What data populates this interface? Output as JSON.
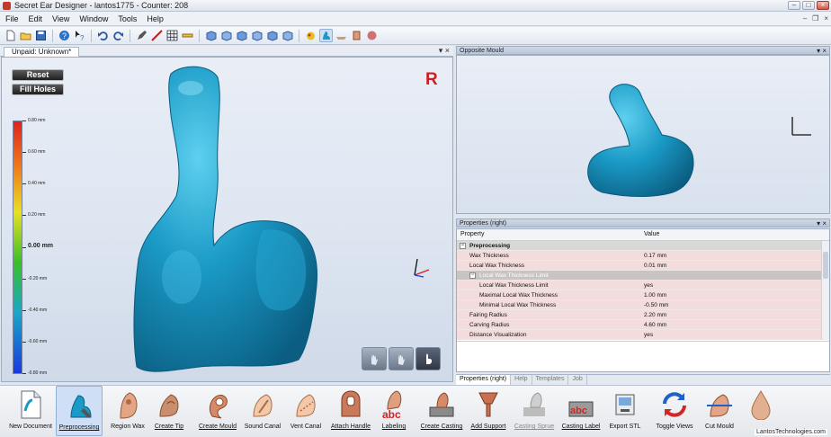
{
  "window": {
    "title": "Secret Ear Designer - lantos1775 - Counter: 208"
  },
  "menu": [
    "File",
    "Edit",
    "View",
    "Window",
    "Tools",
    "Help"
  ],
  "toolbar": {
    "icons": [
      "new-icon",
      "open-icon",
      "save-icon",
      "help-icon",
      "context-help-icon",
      "undo-icon",
      "redo-icon",
      "pen-icon",
      "slice-icon",
      "grid-icon",
      "ruler-icon",
      "view-cube-front-icon",
      "view-cube-back-icon",
      "view-cube-left-icon",
      "view-cube-right-icon",
      "view-cube-top-icon",
      "view-cube-bottom-icon",
      "color-shell-icon",
      "shell-display-icon",
      "tool-a-icon",
      "tool-b-icon",
      "tool-c-icon"
    ]
  },
  "left_pane": {
    "tab_label": "Unpaid: Unknown*",
    "reset_label": "Reset",
    "fill_holes_label": "Fill Holes",
    "side_marker": "R",
    "colorbar_labels": [
      "0.80 mm",
      "0.60 mm",
      "0.40 mm",
      "0.20 mm",
      "0.00 mm",
      "-0.20 mm",
      "-0.40 mm",
      "-0.60 mm",
      "-0.80 mm"
    ]
  },
  "opposite_pane": {
    "title": "Opposite Mould"
  },
  "properties": {
    "title": "Properties (right)",
    "col_property": "Property",
    "col_value": "Value",
    "rows": [
      {
        "type": "cat",
        "name": "Preprocessing",
        "value": ""
      },
      {
        "type": "item",
        "name": "Wax Thickness",
        "value": "0.17 mm"
      },
      {
        "type": "item",
        "name": "Local Wax Thickness",
        "value": "0.01 mm"
      },
      {
        "type": "subcat",
        "name": "Local Wax Thickness Limit",
        "value": ""
      },
      {
        "type": "subitem",
        "name": "Local Wax Thickness Limit",
        "value": "yes"
      },
      {
        "type": "subitem",
        "name": "Maximal Local Wax Thickness",
        "value": "1.00 mm"
      },
      {
        "type": "subitem",
        "name": "Minimal Local Wax Thickness",
        "value": "-0.50 mm"
      },
      {
        "type": "item",
        "name": "Fairing Radius",
        "value": "2.20 mm"
      },
      {
        "type": "item",
        "name": "Carving Radius",
        "value": "4.60 mm"
      },
      {
        "type": "item",
        "name": "Distance Visualization",
        "value": "yes"
      }
    ],
    "tabs": [
      "Properties (right)",
      "Help",
      "Templates",
      "Job"
    ]
  },
  "bottom_tools": [
    {
      "label": "New Document",
      "icon": "new-document-icon",
      "style": "plain"
    },
    {
      "label": "Preprocessing",
      "icon": "preprocessing-icon",
      "style": "selected"
    },
    {
      "label": "Region Wax",
      "icon": "region-wax-icon",
      "style": "plain"
    },
    {
      "label": "Create Tip",
      "icon": "create-tip-icon",
      "style": "underline"
    },
    {
      "label": "Create Mould",
      "icon": "create-mould-icon",
      "style": "underline"
    },
    {
      "label": "Sound Canal",
      "icon": "sound-canal-icon",
      "style": "plain"
    },
    {
      "label": "Vent Canal",
      "icon": "vent-canal-icon",
      "style": "plain"
    },
    {
      "label": "Attach Handle",
      "icon": "attach-handle-icon",
      "style": "underline"
    },
    {
      "label": "Labeling",
      "icon": "labeling-icon",
      "style": "underline"
    },
    {
      "label": "Create Casting",
      "icon": "create-casting-icon",
      "style": "underline"
    },
    {
      "label": "Add Support",
      "icon": "add-support-icon",
      "style": "underline"
    },
    {
      "label": "Casting Sprue",
      "icon": "casting-sprue-icon",
      "style": "disabled"
    },
    {
      "label": "Casting Label",
      "icon": "casting-label-icon",
      "style": "underline"
    },
    {
      "label": "Export STL",
      "icon": "export-stl-icon",
      "style": "plain"
    },
    {
      "label": "Toggle Views",
      "icon": "toggle-views-icon",
      "style": "plain"
    },
    {
      "label": "Cut Mould",
      "icon": "cut-mould-icon",
      "style": "plain"
    },
    {
      "label": "",
      "icon": "drop-shape-icon",
      "style": "plain"
    }
  ],
  "watermark": "LantosTechnologies.com",
  "colors": {
    "model": "#1a9ac6",
    "accent_red": "#d11d1d",
    "property_row": "#f3dcdc"
  }
}
